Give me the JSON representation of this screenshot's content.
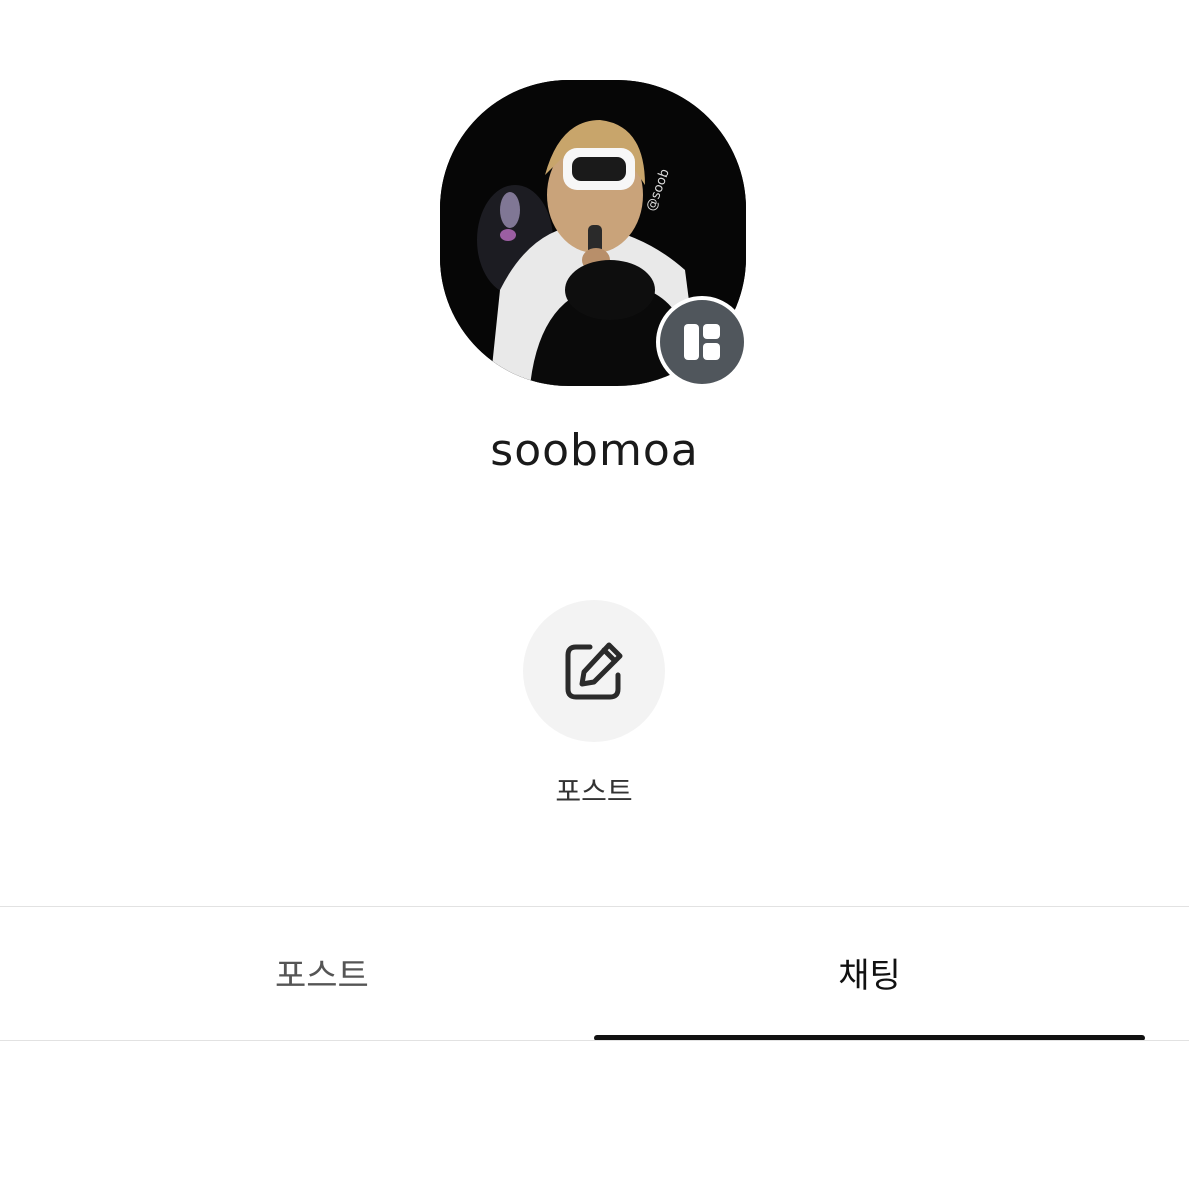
{
  "profile": {
    "photo_icon": "profile-photo",
    "photo_watermark": "@soob",
    "badge_icon": "channel-icon",
    "username": "soobmoa"
  },
  "actions": [
    {
      "icon": "edit-icon",
      "label": "포스트"
    }
  ],
  "tabs": [
    {
      "label": "포스트",
      "active": false
    },
    {
      "label": "채팅",
      "active": true
    }
  ],
  "colors": {
    "badge_bg": "#50565c",
    "action_circle_bg": "#f3f3f3",
    "active_indicator": "#111111",
    "divider": "#e2e2e2"
  }
}
